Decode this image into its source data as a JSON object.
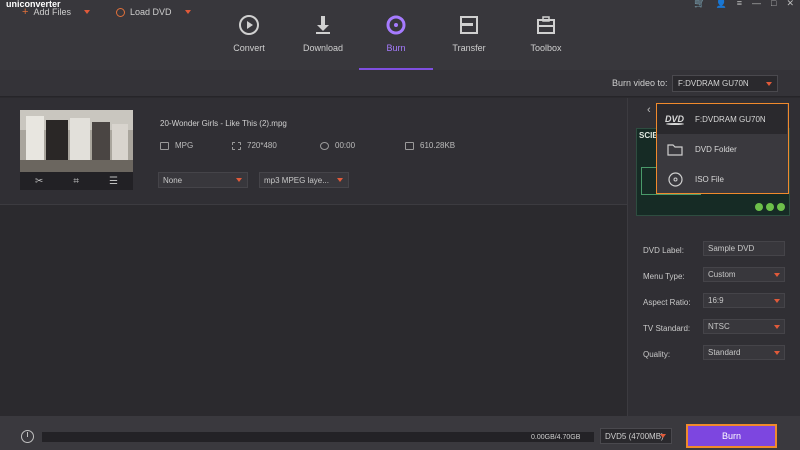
{
  "app": {
    "title": "uniconverter",
    "window_controls": [
      "🛒",
      "👤",
      "≡",
      "—",
      "□",
      "✕"
    ]
  },
  "tabs": [
    {
      "label": "Convert",
      "icon": "convert-icon"
    },
    {
      "label": "Download",
      "icon": "download-icon"
    },
    {
      "label": "Burn",
      "icon": "burn-icon",
      "active": true
    },
    {
      "label": "Transfer",
      "icon": "transfer-icon"
    },
    {
      "label": "Toolbox",
      "icon": "toolbox-icon"
    }
  ],
  "toolbar": {
    "add_files": "Add Files",
    "load_dvd": "Load DVD",
    "burn_video_to": "Burn video to:",
    "burn_target": "F:DVDRAM GU70N"
  },
  "file": {
    "name": "20-Wonder Girls - Like This (2).mpg",
    "format": "MPG",
    "resolution": "720*480",
    "duration": "00:00",
    "size": "610.28KB",
    "subtitle": "None",
    "audio": "mp3 MPEG laye..."
  },
  "dropdown": {
    "items": [
      {
        "label": "F:DVDRAM GU70N",
        "icon": "dvd-icon"
      },
      {
        "label": "DVD Folder",
        "icon": "folder-icon"
      },
      {
        "label": "ISO File",
        "icon": "iso-disc-icon"
      }
    ]
  },
  "preview": {
    "title": "SCIE"
  },
  "settings": {
    "dvd_label_label": "DVD Label:",
    "dvd_label_value": "Sample DVD",
    "menu_type_label": "Menu Type:",
    "menu_type_value": "Custom",
    "aspect_ratio_label": "Aspect Ratio:",
    "aspect_ratio_value": "16:9",
    "tv_standard_label": "TV Standard:",
    "tv_standard_value": "NTSC",
    "quality_label": "Quality:",
    "quality_value": "Standard"
  },
  "bottom": {
    "capacity": "0.00GB/4.70GB",
    "disc_type": "DVD5 (4700MB)",
    "burn_label": "Burn",
    "progress_fraction": 0.0
  },
  "colors": {
    "accent": "#7d46e0",
    "highlight": "#f08a2c"
  }
}
